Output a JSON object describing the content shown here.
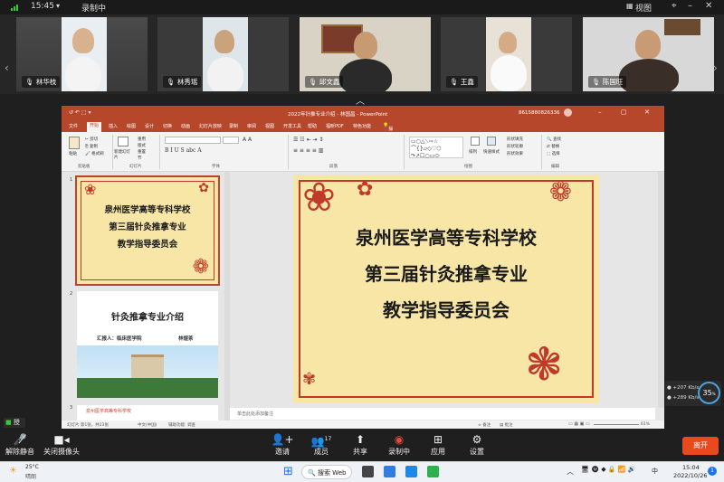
{
  "status": {
    "time": "15:45",
    "recording": "录制中",
    "view_label": "视图"
  },
  "participants": [
    {
      "name": "林华枝"
    },
    {
      "name": "林秀瑶"
    },
    {
      "name": "邱文鑫"
    },
    {
      "name": "王鑫"
    },
    {
      "name": "陈国旺"
    }
  ],
  "ppt": {
    "title": "2022年针推专业介绍 - 林国昌 - PowerPoint",
    "account": "8615880826336",
    "tabs": [
      "文件",
      "开始",
      "插入",
      "绘图",
      "设计",
      "切换",
      "动画",
      "幻灯片放映",
      "录制",
      "审阅",
      "视图",
      "开发工具",
      "帮助",
      "福昕PDF",
      "特色功能",
      "操作说明搜索"
    ],
    "groups": [
      "剪贴板",
      "幻灯片",
      "字体",
      "段落",
      "绘图",
      "编辑"
    ],
    "ribbon_items": {
      "paste": "粘贴",
      "cut": "剪切",
      "copy": "复制",
      "format_painter": "格式刷",
      "new_slide": "新建幻灯片",
      "reuse": "重用",
      "layout": "版式",
      "reset": "重置",
      "section": "节",
      "arrange": "排列",
      "quick_styles": "快速样式",
      "shape_fill": "形状填充",
      "shape_outline": "形状轮廓",
      "shape_effects": "形状效果",
      "find": "查找",
      "replace": "替换",
      "select": "选择"
    },
    "slides": [
      {
        "number": "1",
        "lines": [
          "泉州医学高等专科学校",
          "第三届针灸推拿专业",
          "教学指导委员会"
        ]
      },
      {
        "number": "2",
        "title": "针灸推拿专业介绍",
        "reporter": "汇报人：临床医学院",
        "reporter_name": "林煜茶"
      },
      {
        "number": "3",
        "footer": "泉州医学高等专科学校"
      }
    ],
    "main_slide": {
      "lines": [
        "泉州医学高等专科学校",
        "第三届针灸推拿专业",
        "教学指导委员会"
      ]
    },
    "notes_placeholder": "单击此处添加备注",
    "status": {
      "slide_info": "幻灯片 第1张，共23张",
      "language": "中文(中国)",
      "accessibility": "辅助功能: 调查",
      "notes": "备注",
      "comments": "批注",
      "zoom": "61%"
    }
  },
  "stats": {
    "up": "207",
    "up_unit": "Kb/s",
    "down": "289",
    "down_unit": "Kb/s",
    "percent": "35",
    "percent_unit": "%"
  },
  "hand_label": "授",
  "toolbar": {
    "unmute": "解除静音",
    "camera_off": "关闭摄像头",
    "invite": "邀请",
    "members": "成员",
    "members_count": "17",
    "share": "共享",
    "record": "录制中",
    "apps": "应用",
    "settings": "设置",
    "leave": "离开"
  },
  "taskbar": {
    "temp": "25°C",
    "weather": "晴朗",
    "search": "搜索 Web",
    "clock_time": "15:04",
    "clock_date": "2022/10/26",
    "ime": "中",
    "notif": "1"
  }
}
